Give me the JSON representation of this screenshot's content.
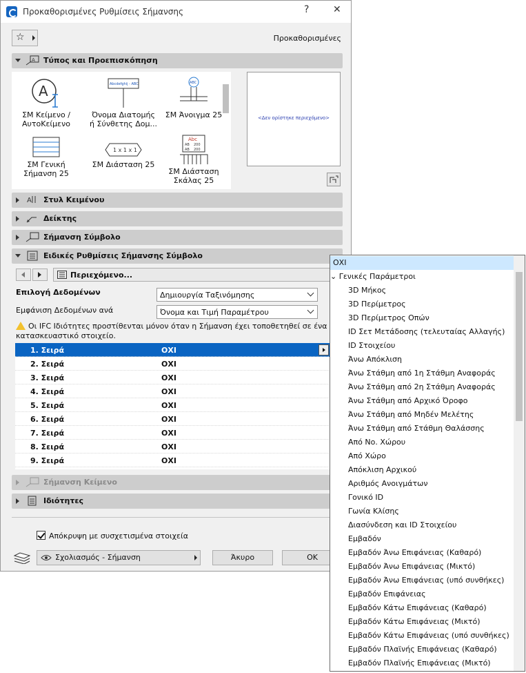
{
  "window": {
    "title": "Προκαθορισμένες Ρυθμίσεις Σήμανσης",
    "help": "?",
    "close": "✕"
  },
  "favorites": {
    "star": "☆",
    "preset_label": "Προκαθορισμένες"
  },
  "sections": {
    "type_preview": "Τύπος και Προεπισκόπηση",
    "text_style": "Στυλ Κειμένου",
    "pointer": "Δείκτης",
    "symbol_label": "Σήμανση Σύμβολο",
    "special_settings": "Ειδικές Ρυθμίσεις Σήμανσης Σύμβολο",
    "text_label": "Σήμανση Κείμενο",
    "properties": "Ιδιότητες"
  },
  "tiles": [
    {
      "label": "ΣΜ Κείμενο / ΑυτοΚείμενο"
    },
    {
      "label": "Όνομα Διατομής ή Σύνθετης Δομ..."
    },
    {
      "label": "ΣΜ Άνοιγμα 25"
    },
    {
      "label": "ΣΜ Γενική Σήμανση 25"
    },
    {
      "label": "ΣΜ Διάσταση 25"
    },
    {
      "label": "ΣΜ Διάσταση Σκάλας 25"
    }
  ],
  "tile_art": {
    "profile_tag": "Abcdefghij - ABC",
    "opening_tag": "ABC",
    "dim_tag": "1 x 1 x 1",
    "stair_tag": "Abc",
    "stair_values": [
      "AB",
      "200",
      "AB",
      "200"
    ]
  },
  "preview": {
    "empty_text": "<Δεν ορίστηκε περιεχόμενο>"
  },
  "content_button": "Περιεχόμενο...",
  "fields": [
    {
      "label": "Επιλογή Δεδομένων",
      "value": "Δημιουργία Ταξινόμησης"
    },
    {
      "label": "Εμφάνιση Δεδομένων ανά",
      "value": "Όνομα και Τιμή Παραμέτρου"
    }
  ],
  "warning": "Οι IFC Ιδιότητες προστίθενται μόνον όταν η Σήμανση έχει τοποθετηθεί σε ένα κατασκευαστικό στοιχείο.",
  "rows": [
    {
      "name": "1. Σειρά",
      "value": "ΟΧΙ"
    },
    {
      "name": "2. Σειρά",
      "value": "ΟΧΙ"
    },
    {
      "name": "3. Σειρά",
      "value": "ΟΧΙ"
    },
    {
      "name": "4. Σειρά",
      "value": "ΟΧΙ"
    },
    {
      "name": "5. Σειρά",
      "value": "ΟΧΙ"
    },
    {
      "name": "6. Σειρά",
      "value": "ΟΧΙ"
    },
    {
      "name": "7. Σειρά",
      "value": "ΟΧΙ"
    },
    {
      "name": "8. Σειρά",
      "value": "ΟΧΙ"
    },
    {
      "name": "9. Σειρά",
      "value": "ΟΧΙ"
    }
  ],
  "hide_checkbox": {
    "label": "Απόκρυψη με συσχετισμένα στοιχεία",
    "checked": true
  },
  "footer": {
    "layer": "Σχολιασμός - Σήμανση",
    "cancel": "Άκυρο",
    "ok": "OK"
  },
  "popup": {
    "items": [
      {
        "label": "ΟΧΙ",
        "kind": "top",
        "highlighted": true
      },
      {
        "label": "Γενικές Παράμετροι",
        "kind": "group"
      },
      {
        "label": "3D Μήκος",
        "kind": "sub"
      },
      {
        "label": "3D Περίμετρος",
        "kind": "sub"
      },
      {
        "label": "3D Περίμετρος Οπών",
        "kind": "sub"
      },
      {
        "label": "ID Σετ Μετάδοσης (τελευταίας Αλλαγής)",
        "kind": "sub"
      },
      {
        "label": "ID Στοιχείου",
        "kind": "sub"
      },
      {
        "label": "Άνω Απόκλιση",
        "kind": "sub"
      },
      {
        "label": "Άνω Στάθμη από 1η Στάθμη Αναφοράς",
        "kind": "sub"
      },
      {
        "label": "Άνω Στάθμη από 2η Στάθμη Αναφοράς",
        "kind": "sub"
      },
      {
        "label": "Άνω Στάθμη από Αρχικό Όροφο",
        "kind": "sub"
      },
      {
        "label": "Άνω Στάθμη από Μηδέν Μελέτης",
        "kind": "sub"
      },
      {
        "label": "Άνω Στάθμη από Στάθμη Θαλάσσης",
        "kind": "sub"
      },
      {
        "label": "Από Νο. Χώρου",
        "kind": "sub"
      },
      {
        "label": "Από Χώρο",
        "kind": "sub"
      },
      {
        "label": "Απόκλιση Αρχικού",
        "kind": "sub"
      },
      {
        "label": "Αριθμός Ανοιγμάτων",
        "kind": "sub"
      },
      {
        "label": "Γονικό ID",
        "kind": "sub"
      },
      {
        "label": "Γωνία Κλίσης",
        "kind": "sub"
      },
      {
        "label": "Διασύνδεση και ID Στοιχείου",
        "kind": "sub"
      },
      {
        "label": "Εμβαδόν",
        "kind": "sub"
      },
      {
        "label": "Εμβαδόν Άνω Επιφάνειας (Καθαρό)",
        "kind": "sub"
      },
      {
        "label": "Εμβαδόν Άνω Επιφάνειας (Μικτό)",
        "kind": "sub"
      },
      {
        "label": "Εμβαδόν Άνω Επιφάνειας (υπό συνθήκες)",
        "kind": "sub"
      },
      {
        "label": "Εμβαδόν Επιφάνειας",
        "kind": "sub"
      },
      {
        "label": "Εμβαδόν Κάτω Επιφάνειας (Καθαρό)",
        "kind": "sub"
      },
      {
        "label": "Εμβαδόν Κάτω Επιφάνειας (Μικτό)",
        "kind": "sub"
      },
      {
        "label": "Εμβαδόν Κάτω Επιφάνειας (υπό συνθήκες)",
        "kind": "sub"
      },
      {
        "label": "Εμβαδόν Πλαϊνής Επιφάνειας (Καθαρό)",
        "kind": "sub"
      },
      {
        "label": "Εμβαδόν Πλαϊνής Επιφάνειας (Μικτό)",
        "kind": "sub"
      }
    ]
  },
  "colors": {
    "selection": "#0a64c2",
    "highlight": "#cde8ff",
    "section_header": "#cdcdcd",
    "accent": "#1565c0"
  }
}
